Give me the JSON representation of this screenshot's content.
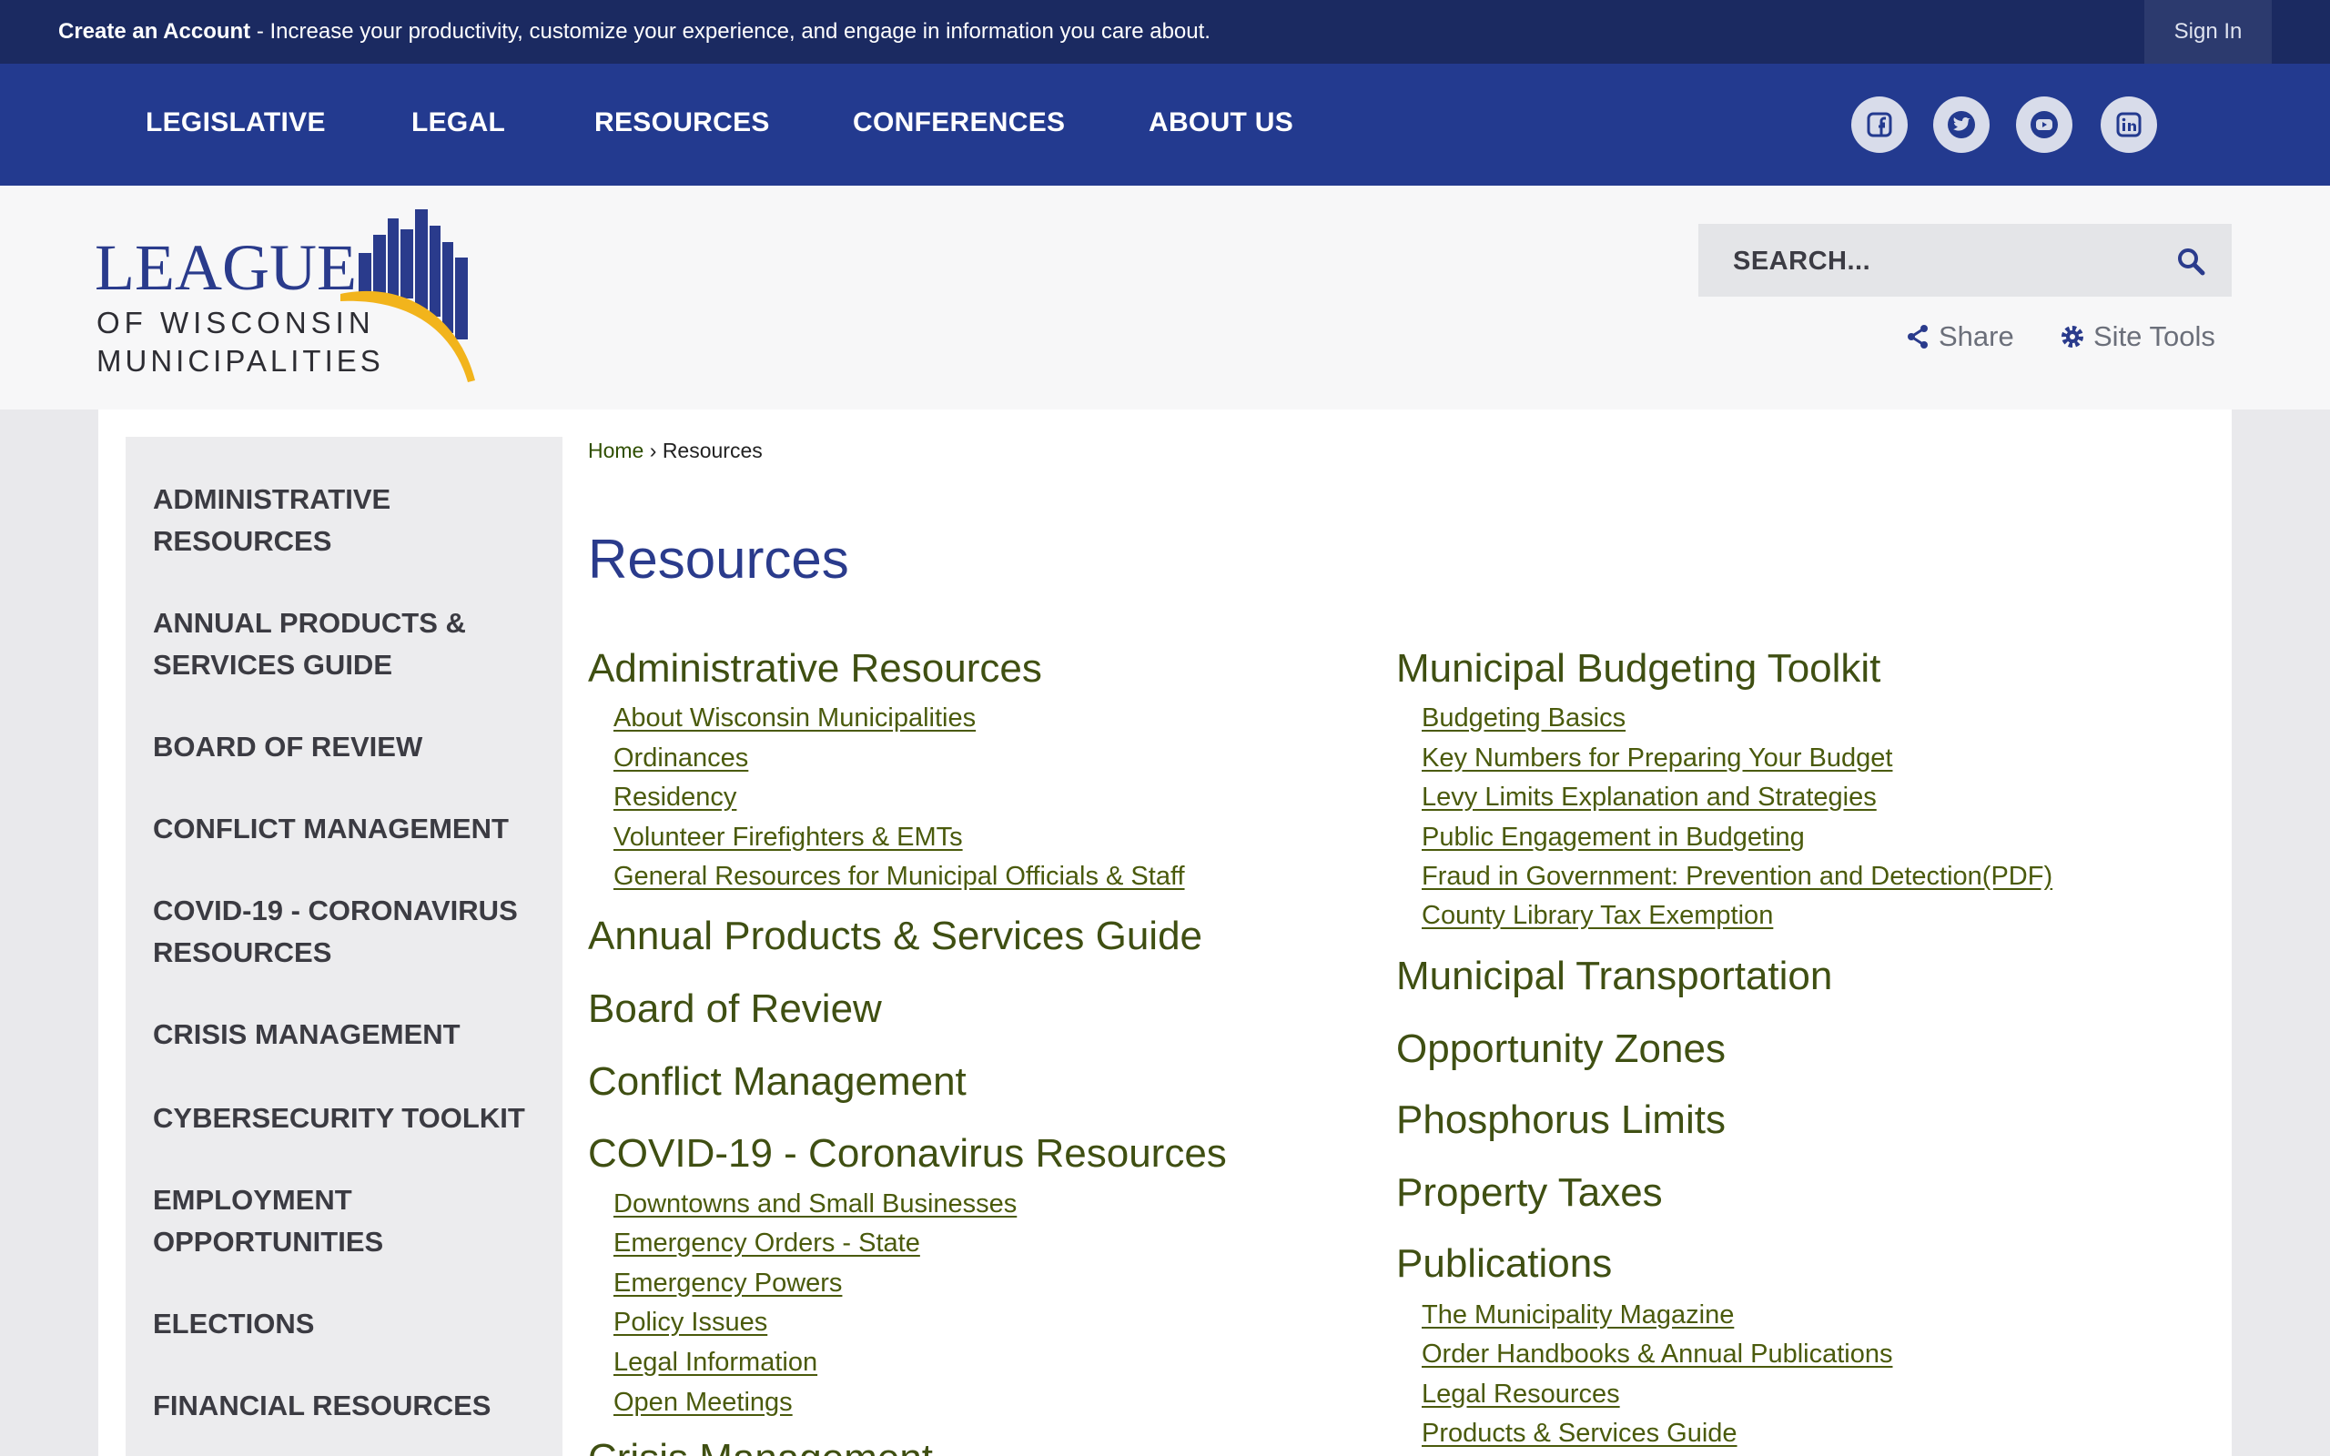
{
  "topbar": {
    "create_label": "Create an Account",
    "message": " - Increase your productivity, customize your experience, and engage in information you care about.",
    "signin_label": "Sign In"
  },
  "nav": {
    "items": [
      "LEGISLATIVE",
      "LEGAL",
      "RESOURCES",
      "CONFERENCES",
      "ABOUT US"
    ],
    "social_icons": [
      "facebook-icon",
      "twitter-icon",
      "youtube-icon",
      "linkedin-icon"
    ]
  },
  "logo": {
    "line1": "LEAGUE",
    "line2": "OF WISCONSIN",
    "line3": "MUNICIPALITIES"
  },
  "search": {
    "placeholder": "SEARCH..."
  },
  "tools": {
    "share": "Share",
    "site_tools": "Site Tools"
  },
  "sidebar": {
    "items": [
      "ADMINISTRATIVE RESOURCES",
      "ANNUAL PRODUCTS & SERVICES GUIDE",
      "BOARD OF REVIEW",
      "CONFLICT MANAGEMENT",
      "COVID-19 - CORONAVIRUS RESOURCES",
      "CRISIS MANAGEMENT",
      "CYBERSECURITY TOOLKIT",
      "EMPLOYMENT OPPORTUNITIES",
      "ELECTIONS",
      "FINANCIAL RESOURCES"
    ]
  },
  "breadcrumb": {
    "home": "Home",
    "separator": " › ",
    "current": "Resources"
  },
  "page_title": "Resources",
  "left": {
    "admin": {
      "title": "Administrative Resources",
      "links": [
        "About Wisconsin Municipalities",
        "Ordinances",
        "Residency",
        "Volunteer Firefighters & EMTs",
        "General Resources for Municipal Officials & Staff"
      ]
    },
    "annual": "Annual Products & Services Guide",
    "board": "Board of Review",
    "conflict": "Conflict Management",
    "covid": {
      "title": "COVID-19 - Coronavirus Resources",
      "links": [
        "Downtowns and Small Businesses",
        "Emergency Orders - State",
        "Emergency Powers",
        "Policy Issues",
        "Legal Information",
        "Open Meetings"
      ]
    },
    "crisis_partial": "Crisis Management"
  },
  "right": {
    "budget": {
      "title": "Municipal Budgeting Toolkit",
      "links": [
        "Budgeting Basics",
        "Key Numbers for Preparing Your Budget",
        "Levy Limits Explanation and Strategies",
        "Public Engagement in Budgeting",
        "Fraud in Government: Prevention and Detection(PDF)",
        "County Library Tax Exemption"
      ]
    },
    "transport": "Municipal Transportation",
    "opportunity": "Opportunity Zones",
    "phosphorus": "Phosphorus Limits",
    "property": "Property Taxes",
    "publications": {
      "title": "Publications",
      "links": [
        "The Municipality Magazine",
        "Order Handbooks & Annual Publications",
        "Legal Resources",
        "Products & Services Guide"
      ]
    }
  },
  "colors": {
    "topbar": "#1b2a61",
    "nav": "#233a8f",
    "heading_link": "#3f4f12",
    "page_title": "#2a3b8c",
    "logo_gold": "#f2b41c"
  }
}
